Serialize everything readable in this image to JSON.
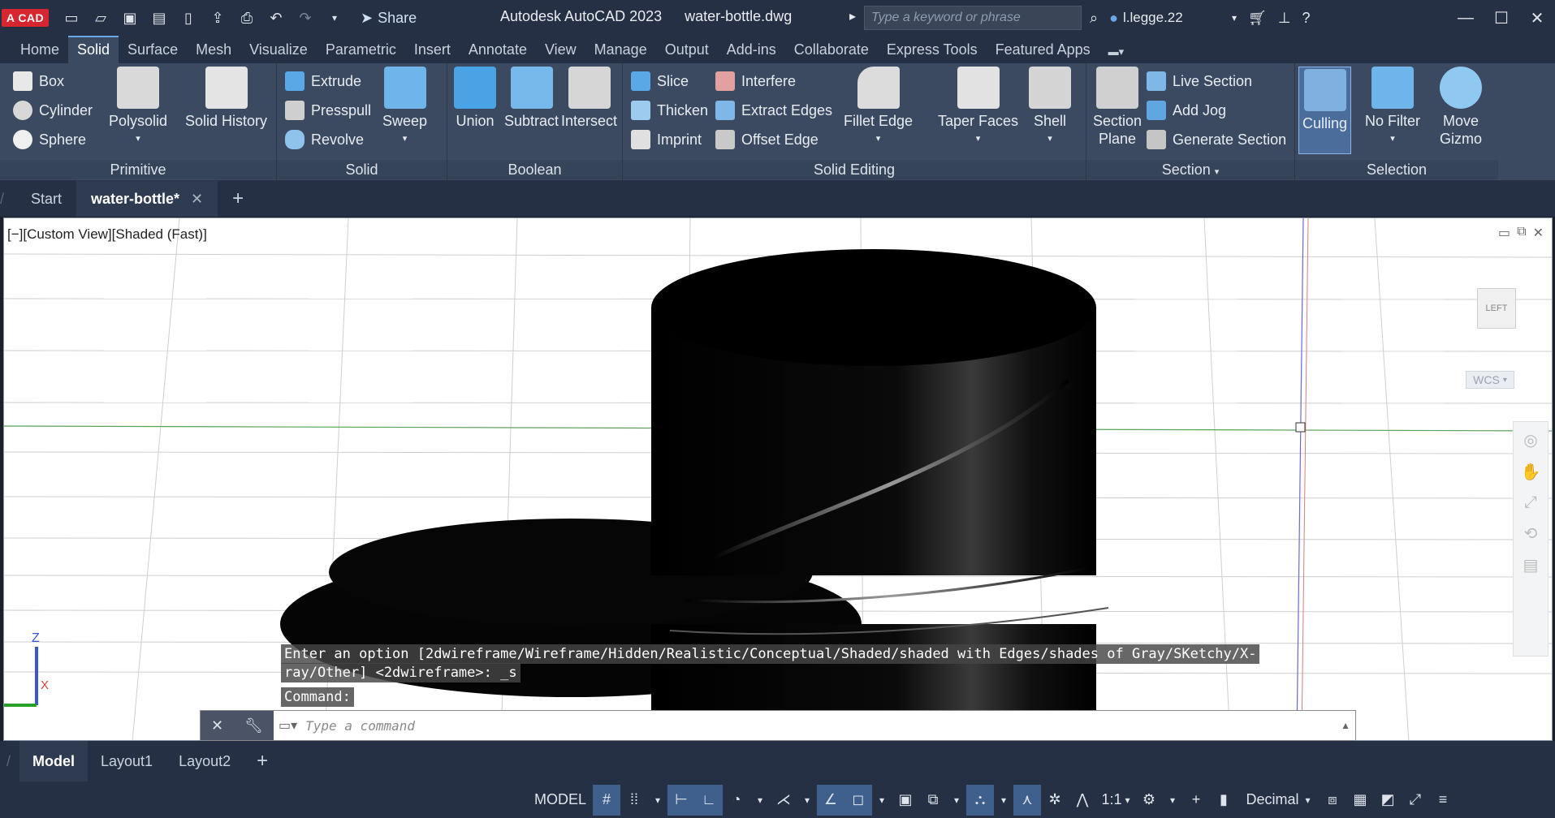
{
  "app": {
    "logo": "A CAD",
    "title": "Autodesk AutoCAD 2023",
    "file": "water-bottle.dwg",
    "search_placeholder": "Type a keyword or phrase",
    "user": "l.legge.22",
    "share": "Share"
  },
  "menu_tabs": [
    "Home",
    "Solid",
    "Surface",
    "Mesh",
    "Visualize",
    "Parametric",
    "Insert",
    "Annotate",
    "View",
    "Manage",
    "Output",
    "Add-ins",
    "Collaborate",
    "Express Tools",
    "Featured Apps"
  ],
  "active_menu_tab": "Solid",
  "ribbon": {
    "primitive": {
      "title": "Primitive",
      "items": [
        "Box",
        "Cylinder",
        "Sphere"
      ],
      "large": [
        "Polysolid",
        "Solid History"
      ]
    },
    "solid": {
      "title": "Solid",
      "items": [
        "Extrude",
        "Presspull",
        "Revolve"
      ],
      "large": [
        "Sweep"
      ]
    },
    "boolean": {
      "title": "Boolean",
      "large": [
        "Union",
        "Subtract",
        "Intersect"
      ]
    },
    "solid_editing": {
      "title": "Solid Editing",
      "items_a": [
        "Slice",
        "Thicken",
        "Imprint"
      ],
      "items_b": [
        "Interfere",
        "Extract Edges",
        "Offset Edge"
      ],
      "large": [
        "Fillet Edge",
        "Taper Faces",
        "Shell"
      ]
    },
    "section": {
      "title": "Section",
      "large": [
        "Section Plane"
      ],
      "items": [
        "Live Section",
        "Add Jog",
        "Generate Section"
      ]
    },
    "selection": {
      "title": "Selection",
      "large": [
        "Culling",
        "No Filter",
        "Move Gizmo"
      ]
    }
  },
  "doc_tabs": [
    "Start",
    "water-bottle*"
  ],
  "viewport": {
    "label": "[−][Custom View][Shaded (Fast)]",
    "viewcube_face": "LEFT",
    "wcs": "WCS",
    "ucs_x": "X",
    "ucs_z": "Z"
  },
  "command": {
    "history_1": "Enter an option [2dwireframe/Wireframe/Hidden/Realistic/Conceptual/Shaded/shaded with Edges/shades of Gray/SKetchy/X-",
    "history_2": "ray/Other] <2dwireframe>: _s",
    "history_3": "Command:",
    "placeholder": "Type a command"
  },
  "layout_tabs": [
    "Model",
    "Layout1",
    "Layout2"
  ],
  "status": {
    "model": "MODEL",
    "scale": "1:1",
    "units": "Decimal"
  },
  "colors": {
    "chrome": "#253044",
    "ribbon": "#3b4a61",
    "accent": "#6ba7e8",
    "logo": "#d7262f"
  }
}
